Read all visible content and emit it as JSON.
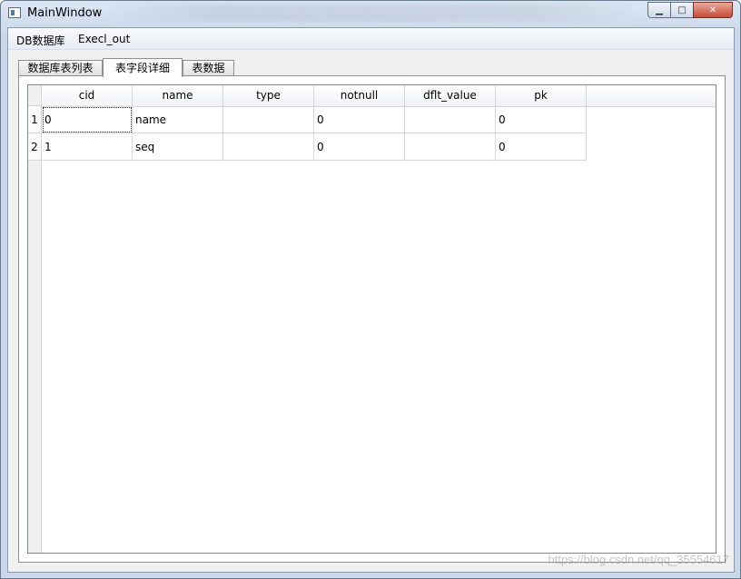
{
  "window": {
    "title": "MainWindow",
    "controls": {
      "minimize": "▁",
      "maximize": "□",
      "close": "✕"
    }
  },
  "menubar": {
    "items": [
      "DB数据库",
      "Execl_out"
    ]
  },
  "tabs": [
    {
      "label": "数据库表列表",
      "active": false
    },
    {
      "label": "表字段详细",
      "active": true
    },
    {
      "label": "表数据",
      "active": false
    }
  ],
  "table": {
    "columns": [
      "cid",
      "name",
      "type",
      "notnull",
      "dflt_value",
      "pk"
    ],
    "row_numbers": [
      "1",
      "2"
    ],
    "rows": [
      [
        "0",
        "name",
        "",
        "0",
        "",
        "0"
      ],
      [
        "1",
        "seq",
        "",
        "0",
        "",
        "0"
      ]
    ]
  },
  "watermark": "https://blog.csdn.net/qq_35554617",
  "colors": {
    "titlebar": "#c9d8ea",
    "close_button": "#c74a35",
    "grid": "#d8d8d8"
  }
}
